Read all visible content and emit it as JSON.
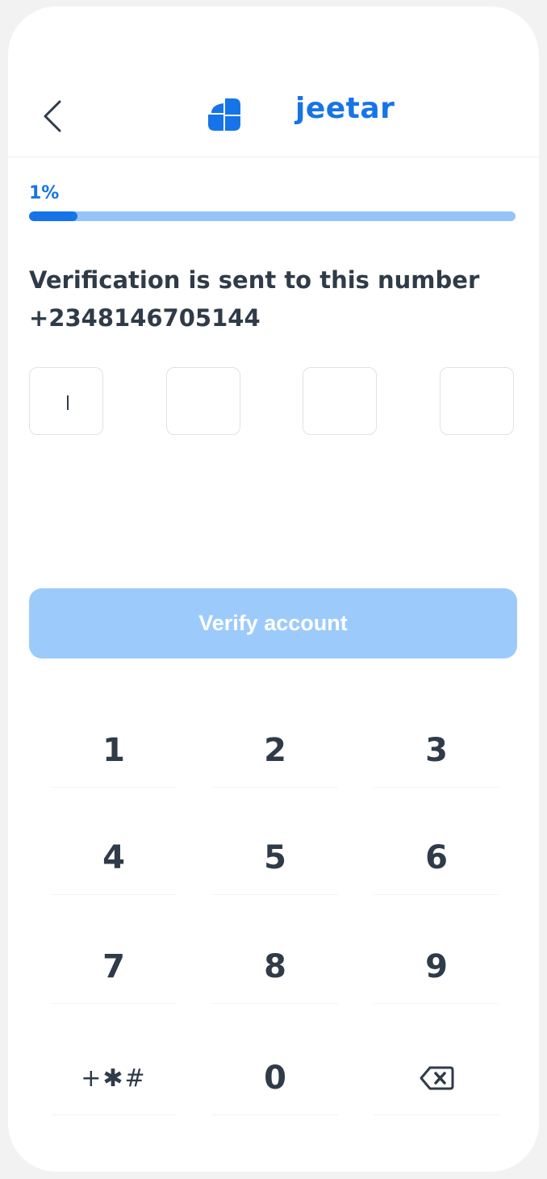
{
  "header": {
    "back_icon": "chevron-left-icon",
    "logo_icon": "jeetar-logo-icon",
    "brand_name": "jeetar"
  },
  "progress": {
    "label": "1%",
    "value_fraction": 0.1
  },
  "verification": {
    "message": "Verification is sent to this number",
    "phone_number": "+2348146705144"
  },
  "otp": {
    "digits": [
      "",
      "",
      "",
      ""
    ]
  },
  "verify_button": {
    "label": "Verify account"
  },
  "keypad": {
    "keys": [
      "1",
      "2",
      "3",
      "4",
      "5",
      "6",
      "7",
      "8",
      "9",
      "+✱#",
      "0",
      ""
    ],
    "backspace_icon": "backspace-icon"
  },
  "colors": {
    "accent": "#1774e8",
    "accent_light": "#96c4f8",
    "button_disabled": "#9ccbfb",
    "text_dark": "#2f3b48"
  }
}
